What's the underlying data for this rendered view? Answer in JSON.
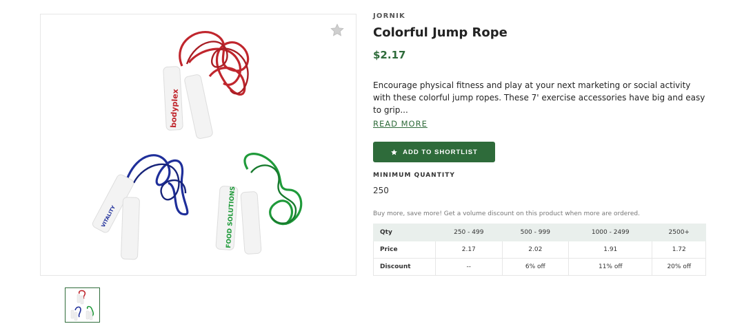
{
  "product": {
    "brand": "JORNIK",
    "title": "Colorful Jump Rope",
    "price": "$2.17",
    "description": "Encourage physical fitness and play at your next marketing or social activity with these colorful jump ropes. These 7' exercise accessories have big and easy to grip...",
    "read_more_label": "READ MORE",
    "shortlist_label": "ADD TO SHORTLIST",
    "min_quantity_label": "MINIMUM QUANTITY",
    "min_quantity_value": "250",
    "volume_note": "Buy more, save more! Get a volume discount on this product when more are ordered."
  },
  "image_labels": {
    "red_handle": "bodyplex",
    "blue_handle": "VITALITY",
    "green_handle": "FOOD SOLUTIONS"
  },
  "pricing_table": {
    "header": [
      "Qty",
      "250 - 499",
      "500 - 999",
      "1000 - 2499",
      "2500+"
    ],
    "price_row": [
      "Price",
      "2.17",
      "2.02",
      "1.91",
      "1.72"
    ],
    "discount_row": [
      "Discount",
      "--",
      "6% off",
      "11% off",
      "20% off"
    ]
  },
  "colors": {
    "accent": "#2e6b3a",
    "table_header_bg": "#e9efec",
    "rope_red": "#c0262d",
    "rope_blue": "#1f2f9a",
    "rope_green": "#1f9a3a"
  },
  "icons": {
    "favorite": "star-icon",
    "shortlist": "star-icon"
  }
}
